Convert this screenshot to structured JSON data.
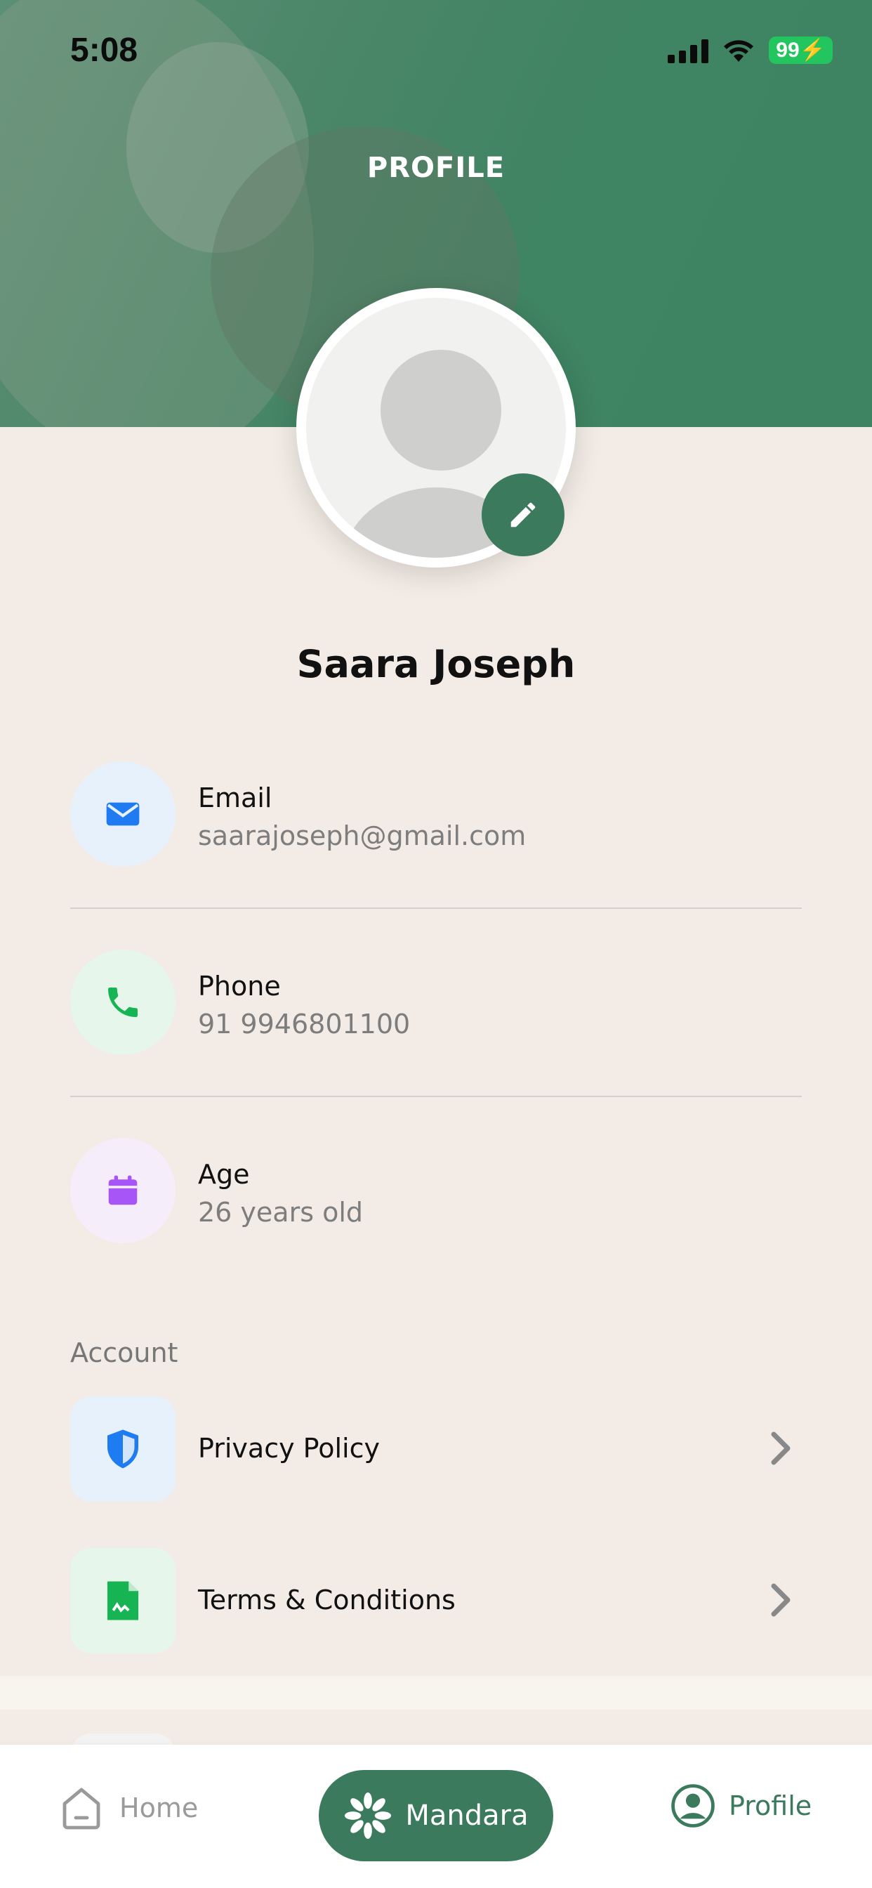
{
  "status_bar": {
    "time": "5:08",
    "battery": "99"
  },
  "header": {
    "title": "PROFILE"
  },
  "profile": {
    "name": "Saara Joseph"
  },
  "info": [
    {
      "label": "Email",
      "value": "saarajoseph@gmail.com",
      "icon": "mail-icon",
      "color": "#1e7bf2",
      "bg": "#e7f1fb"
    },
    {
      "label": "Phone",
      "value": "91 9946801100",
      "icon": "phone-icon",
      "color": "#16b453",
      "bg": "#e6f6ea"
    },
    {
      "label": "Age",
      "value": "26 years old",
      "icon": "calendar-icon",
      "color": "#a855f7",
      "bg": "#f5edf9"
    }
  ],
  "account": {
    "section_label": "Account",
    "items": [
      {
        "label": "Privacy Policy",
        "icon": "shield-icon",
        "color": "#1e7bf2",
        "bg": "#e7f1fb"
      },
      {
        "label": "Terms & Conditions",
        "icon": "document-icon",
        "color": "#16b453",
        "bg": "#e6f6ea"
      }
    ]
  },
  "tabbar": {
    "home": "Home",
    "center": "Mandara",
    "profile": "Profile",
    "accent": "#3c7a5d"
  }
}
